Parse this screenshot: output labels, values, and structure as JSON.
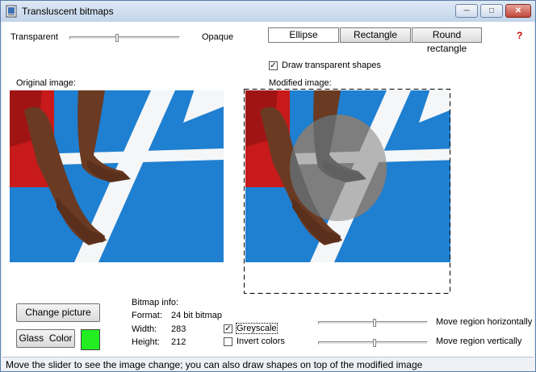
{
  "window": {
    "title": "Transluscent bitmaps"
  },
  "controls": {
    "transparent_label": "Transparent",
    "opaque_label": "Opaque",
    "help_glyph": "?",
    "shape_buttons": [
      {
        "label": "Ellipse",
        "selected": true
      },
      {
        "label": "Rectangle",
        "selected": false
      },
      {
        "label": "Round rectangle",
        "selected": false
      }
    ],
    "draw_transparent_label": "Draw transparent shapes",
    "draw_transparent_checked": true
  },
  "images": {
    "original_label": "Original image:",
    "modified_label": "Modified image:"
  },
  "buttons": {
    "change_picture": "Change picture",
    "glass_color": "Glass  Color",
    "glass_color_value": "#22ee22"
  },
  "bitmap_info": {
    "title": "Bitmap info:",
    "format_label": "Format:",
    "format_value": "24 bit bitmap",
    "width_label": "Width:",
    "width_value": "283",
    "height_label": "Height:",
    "height_value": "212"
  },
  "options": {
    "greyscale_label": "Greyscale",
    "greyscale_checked": true,
    "invert_label": "Invert colors",
    "invert_checked": false
  },
  "region": {
    "horizontal_label": "Move region horizontally",
    "vertical_label": "Move region vertically"
  },
  "status": {
    "text": "Move the slider to see the image change; you can also draw shapes on top of the modified image"
  },
  "colors": {
    "track_blue": "#1f7fd0",
    "lane_white": "#f4f6f8",
    "skin": "#6b3a22",
    "shirt_red": "#c81a1a"
  }
}
